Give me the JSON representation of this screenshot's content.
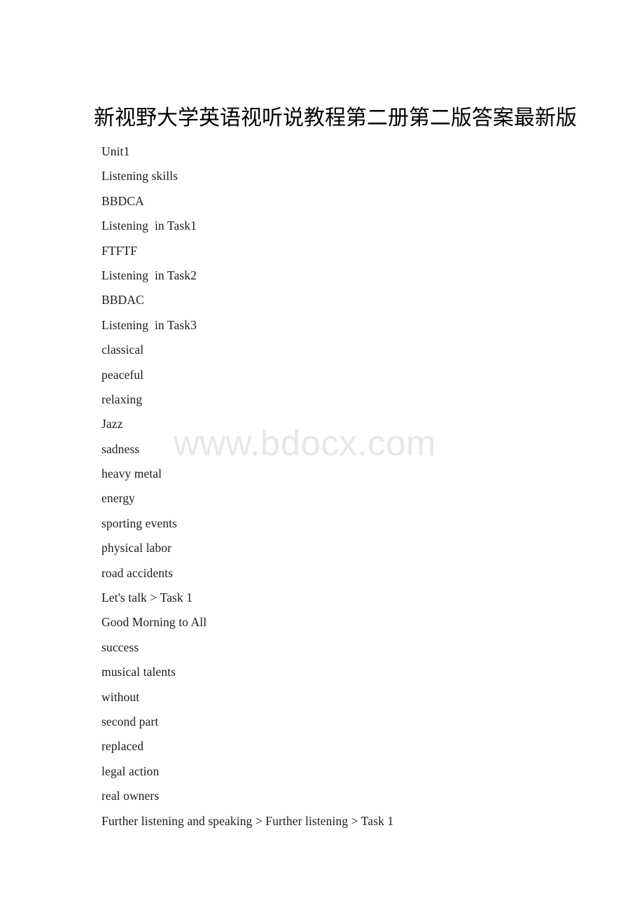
{
  "document": {
    "title": "新视野大学英语视听说教程第二册第二版答案最新版",
    "watermark": "www.bdocx.com",
    "page_background": "#ffffff",
    "text_color": "#1c1c1c",
    "watermark_color": "#e7e7e7",
    "lines": [
      "Unit1",
      "Listening skills",
      "BBDCA",
      "Listening  in Task1",
      "FTFTF",
      "Listening  in Task2",
      "BBDAC",
      "Listening  in Task3",
      "classical",
      "peaceful",
      "relaxing",
      "Jazz",
      "sadness",
      "heavy metal",
      "energy",
      "sporting events",
      "physical labor",
      "road accidents",
      "Let's talk > Task 1",
      "Good Morning to All",
      "success",
      "musical talents",
      "without",
      "second part",
      "replaced",
      "legal action",
      "real owners",
      "Further listening and speaking > Further listening > Task 1"
    ]
  }
}
